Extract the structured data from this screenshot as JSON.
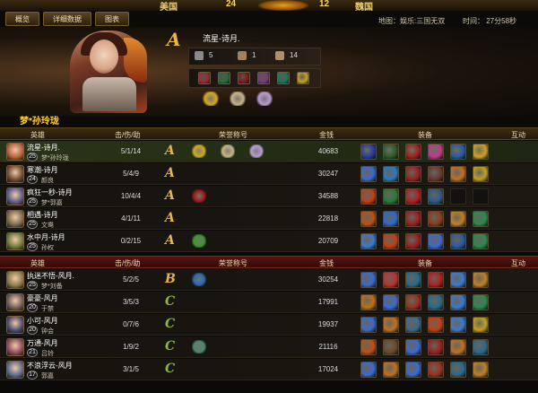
{
  "topbar": {
    "team_left": "美国",
    "score_left": "24",
    "score_right": "12",
    "team_right": "魏国"
  },
  "tabs": [
    "概览",
    "详细数据",
    "图表"
  ],
  "meta": {
    "map": "地图：娱乐:三国无双",
    "time": "时间： 27分58秒"
  },
  "featured": {
    "rank": "A",
    "player": "流星-诗月.",
    "hero": "梦*孙玲珑",
    "stats": [
      {
        "icon": "swords-icon",
        "value": "5"
      },
      {
        "icon": "skull-icon",
        "value": "1"
      },
      {
        "icon": "fist-icon",
        "value": "14"
      }
    ],
    "equipment_colors": [
      "#9a2a30",
      "#2a6a3a",
      "#7a1a1a",
      "#7a3a7a",
      "#1a7a5a",
      "#c8a020"
    ],
    "honor_colors": [
      "#d4a820",
      "#c8b488",
      "#b89ad8"
    ]
  },
  "table1": {
    "headers": {
      "hero": "英雄",
      "kda": "击/伤/助",
      "honor": "荣誉称号",
      "gold": "金钱",
      "equip": "装备",
      "interact": "互动"
    },
    "rows": [
      {
        "player": "流星-诗月.",
        "level": "25",
        "hero": "梦*孙玲珑",
        "kda": "5/1/14",
        "rank": "A",
        "gold": "40683",
        "highlight": true,
        "avatar": "#b0603a",
        "badges": [
          "#d4a820",
          "#c8b488",
          "#b89ad8"
        ],
        "items": [
          "#2a3a9a",
          "#2a5a2a",
          "#a02020",
          "#c03a8a",
          "#2a5aa0",
          "#d0a020"
        ]
      },
      {
        "player": "寒潮-诗月",
        "level": "24",
        "hero": "颜良",
        "kda": "5/4/9",
        "rank": "A",
        "gold": "30247",
        "highlight": false,
        "avatar": "#6a4a30",
        "badges": [],
        "items": [
          "#3a6ad0",
          "#2a7ac0",
          "#9a2020",
          "#6a3a30",
          "#c07020",
          "#c0a020"
        ]
      },
      {
        "player": "疯狂一秒-诗月",
        "level": "25",
        "hero": "梦*郭嘉",
        "kda": "10/4/4",
        "rank": "A",
        "gold": "34588",
        "highlight": false,
        "avatar": "#5a5a8a",
        "badges": [
          "#a01818"
        ],
        "items": [
          "#c04010",
          "#2a7a3a",
          "#b02020",
          "#2a5a8a",
          "empty",
          "empty"
        ]
      },
      {
        "player": "相遇-诗月",
        "level": "25",
        "hero": "文鸯",
        "kda": "4/1/11",
        "rank": "A",
        "gold": "22818",
        "highlight": false,
        "avatar": "#7a6a50",
        "badges": [],
        "items": [
          "#c05010",
          "#2a6ad0",
          "#9a2020",
          "#8a3a20",
          "#c08020",
          "#2a8a4a"
        ]
      },
      {
        "player": "水中月-诗月",
        "level": "25",
        "hero": "孙权",
        "kda": "0/2/15",
        "rank": "A",
        "gold": "20709",
        "highlight": false,
        "avatar": "#6a7a3a",
        "badges": [
          "#3a9a2a"
        ],
        "items": [
          "#3a7ad0",
          "#c04010",
          "#9a2020",
          "#3a6ad0",
          "#2a5aa0",
          "#2a8a4a"
        ]
      }
    ]
  },
  "table2": {
    "headers": {
      "hero": "英雄",
      "kda": "击/伤/助",
      "honor": "荣誉称号",
      "gold": "金钱",
      "equip": "装备",
      "interact": "互动"
    },
    "rows": [
      {
        "player": "执迷不悟-风月.",
        "level": "25",
        "hero": "梦*刘备",
        "kda": "5/2/5",
        "rank": "B",
        "gold": "30254",
        "highlight": false,
        "avatar": "#8a7a4a",
        "badges": [
          "#2a6ab0"
        ],
        "items": [
          "#3a6ad0",
          "#c03030",
          "#2a6a8a",
          "#b02020",
          "#3a7ad0",
          "#c08020"
        ]
      },
      {
        "player": "豪豪-风月",
        "level": "20",
        "hero": "于禁",
        "kda": "3/5/3",
        "rank": "C",
        "gold": "17991",
        "highlight": false,
        "avatar": "#6a5a5a",
        "badges": [],
        "items": [
          "#c07010",
          "#3a6ad0",
          "#9a3020",
          "#2a6a8a",
          "#3a7ad0",
          "#2a8a4a"
        ]
      },
      {
        "player": "小可-风月",
        "level": "20",
        "hero": "钟会",
        "kda": "0/7/6",
        "rank": "C",
        "gold": "19937",
        "highlight": false,
        "avatar": "#4a4a6a",
        "badges": [],
        "items": [
          "#3a6ad0",
          "#c07020",
          "#3a6a8a",
          "#c04010",
          "#3a7ad0",
          "#c0a020"
        ]
      },
      {
        "player": "万通-风月",
        "level": "21",
        "hero": "吕铃",
        "kda": "1/9/2",
        "rank": "C",
        "gold": "21116",
        "highlight": false,
        "avatar": "#8a4a5a",
        "badges": [
          "#4a8a6a"
        ],
        "items": [
          "#c05010",
          "#6a4a2a",
          "#3a6ad0",
          "#9a2020",
          "#c07020",
          "#2a6a8a"
        ]
      },
      {
        "player": "不浪浮云-风月",
        "level": "17",
        "hero": "郭嘉",
        "kda": "3/1/5",
        "rank": "C",
        "gold": "17024",
        "highlight": false,
        "avatar": "#5a6a8a",
        "badges": [],
        "items": [
          "#3a6ad0",
          "#c07020",
          "#3a6ad0",
          "#9a3020",
          "#2a6a8a",
          "#c08020"
        ]
      }
    ]
  },
  "colors": {
    "rank_A": "#e8b450",
    "rank_B": "#e8b450",
    "rank_C": "#8ab83a",
    "accent": "#ffcf40"
  }
}
